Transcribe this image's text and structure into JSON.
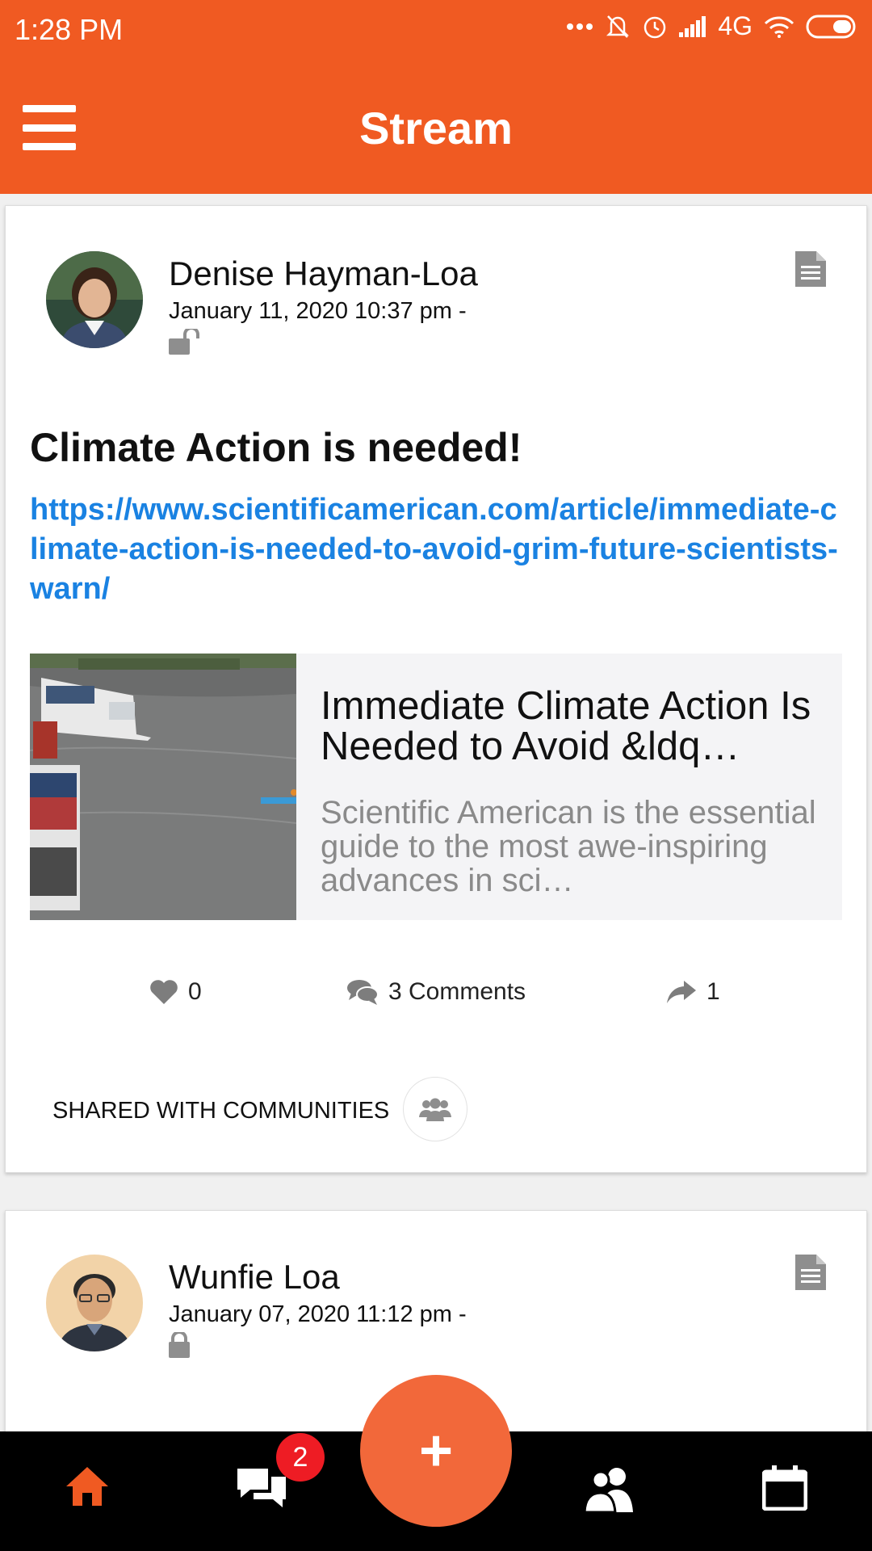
{
  "status_bar": {
    "time": "1:28 PM",
    "network": "4G",
    "icons": [
      "more-dots-icon",
      "bell-muted-icon",
      "alarm-icon",
      "signal-icon",
      "wifi-icon",
      "battery-icon"
    ]
  },
  "app_bar": {
    "title": "Stream",
    "menu_icon": "hamburger-menu-icon"
  },
  "posts": [
    {
      "author": "Denise Hayman-Loa",
      "date": "January 11, 2020 10:37 pm -",
      "visibility_icon": "unlock-icon",
      "type_icon": "document-icon",
      "title": "Climate Action is needed!",
      "link": "https://www.scientificamerican.com/article/immediate-climate-action-is-needed-to-avoid-grim-future-scientists-warn/",
      "preview": {
        "title": "Immediate Climate Action Is Needed to Avoid &ldq…",
        "description": "Scientific American is the essential guide to the most awe-inspiring advances in sci…"
      },
      "likes": "0",
      "comments": "3 Comments",
      "shares": "1",
      "shared_with": "SHARED WITH COMMUNITIES"
    },
    {
      "author": "Wunfie Loa",
      "date": "January 07, 2020 11:12 pm -",
      "visibility_icon": "lock-icon",
      "type_icon": "document-icon"
    }
  ],
  "bottom_nav": {
    "items": [
      "home-icon",
      "chat-icon",
      "add-icon",
      "people-icon",
      "calendar-icon"
    ],
    "chat_badge": "2",
    "fab_label": "+"
  },
  "colors": {
    "brand": "#f05a22",
    "fab": "#f2683a",
    "link": "#1a82e2",
    "badge": "#ee1c24",
    "active_nav": "#f05a22"
  }
}
